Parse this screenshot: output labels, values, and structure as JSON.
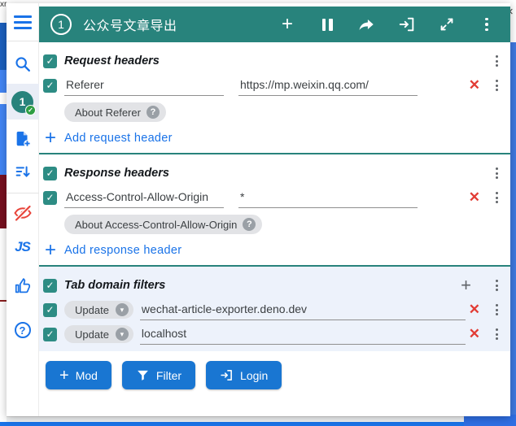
{
  "backdrop": {
    "top_left_fragment": "xr",
    "close_glyph": "×"
  },
  "titlebar": {
    "profile_number": "1",
    "title": "公众号文章导出"
  },
  "sidebar": {
    "profile_number": "1",
    "js_label": "JS",
    "help_glyph": "?"
  },
  "icons": {
    "plus": "+",
    "close": "✕",
    "check": "✓",
    "question": "?",
    "chevron_down": "▾"
  },
  "request_headers": {
    "title": "Request headers",
    "rows": [
      {
        "name": "Referer",
        "value": "https://mp.weixin.qq.com/"
      }
    ],
    "about_label": "About Referer",
    "add_label": "Add request header"
  },
  "response_headers": {
    "title": "Response headers",
    "rows": [
      {
        "name": "Access-Control-Allow-Origin",
        "value": "*"
      }
    ],
    "about_label": "About Access-Control-Allow-Origin",
    "add_label": "Add response header"
  },
  "tab_filters": {
    "title": "Tab domain filters",
    "rows": [
      {
        "type_label": "Update",
        "value": "wechat-article-exporter.deno.dev"
      },
      {
        "type_label": "Update",
        "value": "localhost"
      }
    ]
  },
  "footer": {
    "buttons": [
      {
        "label": "Mod"
      },
      {
        "label": "Filter"
      },
      {
        "label": "Login"
      }
    ]
  },
  "colors": {
    "teal": "#28837c",
    "accent_blue": "#1a73e8",
    "button_blue": "#1976d2",
    "delete_red": "#e23c35",
    "filters_bg": "#edf2fb"
  }
}
